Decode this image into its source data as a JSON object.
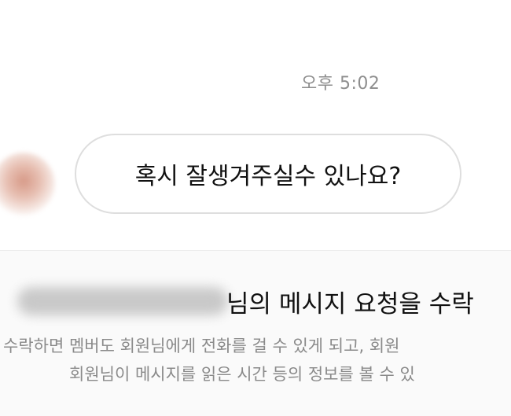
{
  "chat": {
    "timestamp": "오후 5:02",
    "message": "혹시 잘생겨주실수 있나요?"
  },
  "request": {
    "title_suffix": "님의 메시지 요청을 수락",
    "desc_line_1": "수락하면 멤버도 회원님에게 전화를 걸 수 있게 되고, 회원",
    "desc_line_2": "회원님이 메시지를 읽은 시간 등의 정보를 볼 수 있"
  }
}
